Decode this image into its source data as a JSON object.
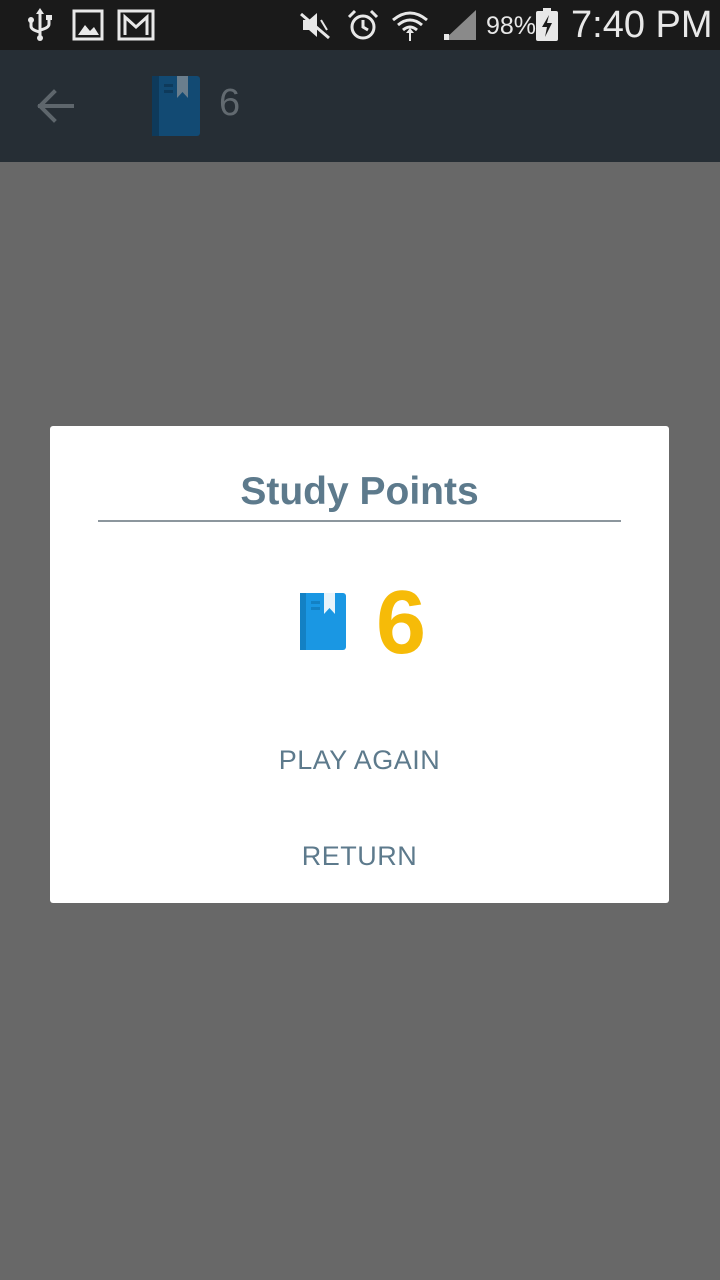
{
  "status_bar": {
    "icons": [
      "usb-icon",
      "image-icon",
      "gmail-icon",
      "mute-icon",
      "alarm-icon",
      "wifi-icon",
      "signal-icon",
      "battery-charging-icon"
    ],
    "battery_percent": "98%",
    "time": "7:40 PM"
  },
  "app_bar": {
    "back_icon": "arrow-back-icon",
    "book_icon": "book-icon",
    "points": "6"
  },
  "dialog": {
    "title": "Study Points",
    "book_icon": "book-icon",
    "points": "6",
    "points_color": "#f6bb08",
    "play_again_label": "PLAY AGAIN",
    "return_label": "RETURN"
  },
  "colors": {
    "overlay": "#686868",
    "app_bar": "#262e35",
    "accent_text": "#5d7a8c",
    "book_blue": "#1a97e3"
  }
}
